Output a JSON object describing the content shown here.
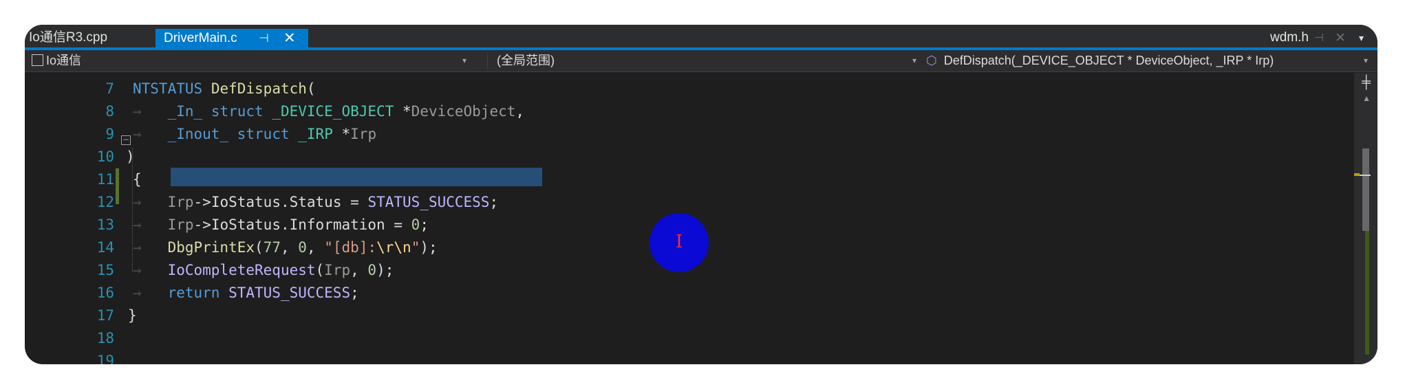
{
  "tabs": {
    "tab1": "Io通信R3.cpp",
    "active": "DriverMain.c",
    "pin_glyph": "⊣",
    "close_glyph": "✕",
    "right": "wdm.h",
    "overflow_glyph": "▾"
  },
  "nav": {
    "project": "Io通信",
    "scope": "(全局范围)",
    "function": "DefDispatch(_DEVICE_OBJECT * DeviceObject, _IRP * Irp)",
    "dropdown_glyph": "▾"
  },
  "editor": {
    "line_numbers": [
      "7",
      "8",
      "9",
      "10",
      "11",
      "12",
      "13",
      "14",
      "15",
      "16",
      "17",
      "18",
      "19"
    ],
    "fold_glyph": "⊟",
    "l7": {
      "ntstatus": "NTSTATUS",
      "name": "DefDispatch",
      "open": "("
    },
    "l8": {
      "ann": "_In_",
      "kw": "struct",
      "type": "_DEVICE_OBJECT",
      "ptr": "*",
      "param": "DeviceObject",
      "comma": ","
    },
    "l9": {
      "ann": "_Inout_",
      "kw": "struct",
      "type": "_IRP",
      "ptr": "*",
      "param": "Irp"
    },
    "l10": {
      "close": ")"
    },
    "l11": {
      "brace": "{"
    },
    "l12": {
      "var": "Irp",
      "arrow": "->",
      "member": "IoStatus.Status",
      "eq": "=",
      "val": "STATUS_SUCCESS",
      "semi": ";"
    },
    "l13": {
      "var": "Irp",
      "arrow": "->",
      "member": "IoStatus.Information",
      "eq": "=",
      "val": "0",
      "semi": ";"
    },
    "l14": {
      "fn": "DbgPrintEx",
      "open": "(",
      "a1": "77",
      "sep1": ",",
      "a2": "0",
      "sep2": ",",
      "s1": "\"[db]:",
      "esc": "\\r\\n",
      "s2": "\"",
      "close": ");"
    },
    "l15": {
      "fn": "IoCompleteRequest",
      "open": "(",
      "a1": "Irp",
      "sep": ",",
      "a2": "0",
      "close": ");"
    },
    "l16": {
      "kw": "return",
      "val": "STATUS_SUCCESS",
      "semi": ";"
    },
    "l17": {
      "brace": "}"
    }
  },
  "scrollbar": {
    "split_glyph": "╪",
    "up_glyph": "▲"
  },
  "colors": {
    "accent": "#007acc",
    "background": "#1e1e1e",
    "cursor_circle": "#0a0ad4"
  }
}
